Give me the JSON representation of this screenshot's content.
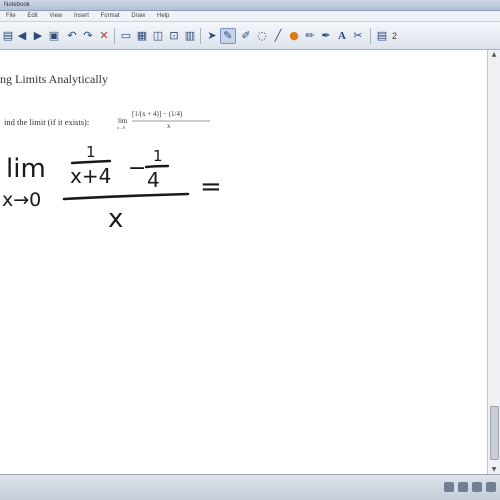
{
  "window": {
    "title": "Notebook"
  },
  "menu": {
    "items": [
      "File",
      "Edit",
      "View",
      "Insert",
      "Format",
      "Draw",
      "Help"
    ]
  },
  "toolbar": {
    "buttons": [
      {
        "icon": "page-icon",
        "glyph": "▤"
      },
      {
        "icon": "prev-page-icon",
        "glyph": "◀"
      },
      {
        "icon": "next-page-icon",
        "glyph": "▶"
      },
      {
        "icon": "paste-icon",
        "glyph": "▣"
      },
      {
        "icon": "undo-icon",
        "glyph": "↶"
      },
      {
        "icon": "redo-icon",
        "glyph": "↷"
      },
      {
        "icon": "delete-icon",
        "glyph": "✕"
      },
      {
        "icon": "screen-shade-icon",
        "glyph": "▭"
      },
      {
        "icon": "display-icon",
        "glyph": "▦"
      },
      {
        "icon": "monitor-icon",
        "glyph": "◫"
      },
      {
        "icon": "capture-icon",
        "glyph": "⊡"
      },
      {
        "icon": "table-icon",
        "glyph": "▥"
      },
      {
        "icon": "select-icon",
        "glyph": "➤"
      },
      {
        "icon": "pen-icon",
        "glyph": "✎"
      },
      {
        "icon": "highlighter-icon",
        "glyph": "✐"
      },
      {
        "icon": "eraser-icon",
        "glyph": "◌"
      },
      {
        "icon": "line-icon",
        "glyph": "╱"
      },
      {
        "icon": "fill-icon",
        "glyph": "●"
      },
      {
        "icon": "shape-icon",
        "glyph": "✏"
      },
      {
        "icon": "magic-pen-icon",
        "glyph": "✒"
      },
      {
        "icon": "text-icon",
        "glyph": "A"
      },
      {
        "icon": "properties-icon",
        "glyph": "✂"
      },
      {
        "icon": "page-sorter-icon",
        "glyph": "▤"
      }
    ],
    "page_number": "2"
  },
  "content": {
    "lesson_title": "ng Limits Analytically",
    "instruction": "ind the limit (if it exists):",
    "typed_expression": {
      "lim_label": "lim",
      "lim_sub": "x→0",
      "numerator": "[1/(x + 4)] − (1/4)",
      "denominator": "x"
    },
    "handwritten": {
      "lim": "lim",
      "approach": "x→0",
      "frac1_num": "1",
      "frac1_den": "x+4",
      "minus": "−",
      "frac2_num": "1",
      "frac2_den": "4",
      "denominator": "x",
      "equals": "="
    }
  },
  "colors": {
    "ink": "#1a1a1a",
    "toolbar_icon": "#2c4a7a"
  }
}
